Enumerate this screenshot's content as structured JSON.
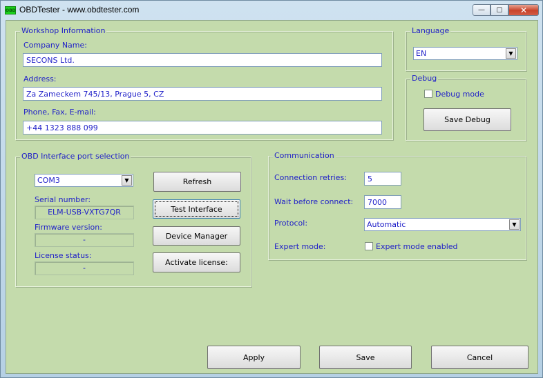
{
  "window": {
    "title": "OBDTester - www.obdtester.com",
    "icon_label": "OBD",
    "icons": {
      "app": "app-icon",
      "minimize": "minimize-icon",
      "maximize": "maximize-icon",
      "close": "close-icon"
    },
    "glyphs": {
      "minimize": "—",
      "maximize": "▢",
      "close": "✕"
    }
  },
  "workshop": {
    "legend": "Workshop Information",
    "company_label": "Company Name:",
    "company_value": "SECONS Ltd.",
    "address_label": "Address:",
    "address_value": "Za Zameckem 745/13, Prague 5, CZ",
    "contact_label": "Phone, Fax, E-mail:",
    "contact_value": "+44 1323 888 099"
  },
  "language": {
    "legend": "Language",
    "selected": "EN"
  },
  "debug": {
    "legend": "Debug",
    "checkbox_label": "Debug mode",
    "checked": false,
    "save_button": "Save Debug"
  },
  "obd": {
    "legend": "OBD Interface port selection",
    "port_selected": "COM3",
    "serial_label": "Serial number:",
    "serial_value": "ELM-USB-VXTG7QR",
    "firmware_label": "Firmware version:",
    "firmware_value": "-",
    "license_label": "License status:",
    "license_value": "-",
    "refresh_button": "Refresh",
    "test_button": "Test Interface",
    "device_manager_button": "Device Manager",
    "activate_button": "Activate license:"
  },
  "communication": {
    "legend": "Communication",
    "retries_label": "Connection retries:",
    "retries_value": "5",
    "wait_label": "Wait before connect:",
    "wait_value": "7000",
    "protocol_label": "Protocol:",
    "protocol_selected": "Automatic",
    "expert_label": "Expert mode:",
    "expert_checkbox_label": "Expert mode enabled",
    "expert_checked": false
  },
  "footer": {
    "apply_button": "Apply",
    "save_button": "Save",
    "cancel_button": "Cancel"
  },
  "colors": {
    "client_background": "#c4dbac",
    "label_text": "#1e1ec8"
  }
}
